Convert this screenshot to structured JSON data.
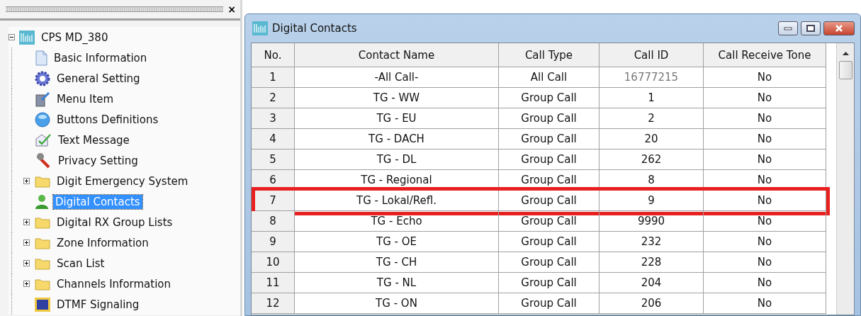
{
  "panel": {
    "close": "×"
  },
  "tree": {
    "label": "CPS MD_380",
    "expanded": true,
    "children": [
      {
        "label": "Basic Information",
        "kind": "document",
        "selected": false
      },
      {
        "label": "General Setting",
        "kind": "gear",
        "selected": false
      },
      {
        "label": "Menu Item",
        "kind": "menu",
        "selected": false
      },
      {
        "label": "Buttons Definitions",
        "kind": "ball",
        "selected": false
      },
      {
        "label": "Text Message",
        "kind": "message",
        "selected": false
      },
      {
        "label": "Privacy Setting",
        "kind": "tool",
        "selected": false
      },
      {
        "label": "Digit Emergency System",
        "kind": "folder",
        "selected": false
      },
      {
        "label": "Digital Contacts",
        "kind": "person",
        "selected": true
      },
      {
        "label": "Digital RX Group Lists",
        "kind": "folder",
        "selected": false
      },
      {
        "label": "Zone Information",
        "kind": "folder",
        "selected": false
      },
      {
        "label": "Scan List",
        "kind": "folder",
        "selected": false
      },
      {
        "label": "Channels Information",
        "kind": "folder",
        "selected": false
      },
      {
        "label": "DTMF Signaling",
        "kind": "dtmf",
        "selected": false
      }
    ]
  },
  "window": {
    "title": "Digital Contacts"
  },
  "table": {
    "columns": [
      "No.",
      "Contact Name",
      "Call Type",
      "Call ID",
      "Call Receive Tone"
    ],
    "rows": [
      {
        "cells": [
          "1",
          "-All Call-",
          "All Call",
          "16777215",
          "No"
        ],
        "id_disabled": true,
        "highlighted": false
      },
      {
        "cells": [
          "2",
          "TG - WW",
          "Group Call",
          "1",
          "No"
        ],
        "id_disabled": false,
        "highlighted": false
      },
      {
        "cells": [
          "3",
          "TG - EU",
          "Group Call",
          "2",
          "No"
        ],
        "id_disabled": false,
        "highlighted": false
      },
      {
        "cells": [
          "4",
          "TG - DACH",
          "Group Call",
          "20",
          "No"
        ],
        "id_disabled": false,
        "highlighted": false
      },
      {
        "cells": [
          "5",
          "TG - DL",
          "Group Call",
          "262",
          "No"
        ],
        "id_disabled": false,
        "highlighted": false
      },
      {
        "cells": [
          "6",
          "TG - Regional",
          "Group Call",
          "8",
          "No"
        ],
        "id_disabled": false,
        "highlighted": false
      },
      {
        "cells": [
          "7",
          "TG - Lokal/Refl.",
          "Group Call",
          "9",
          "No"
        ],
        "id_disabled": false,
        "highlighted": true
      },
      {
        "cells": [
          "8",
          "TG - Echo",
          "Group Call",
          "9990",
          "No"
        ],
        "id_disabled": false,
        "highlighted": false
      },
      {
        "cells": [
          "9",
          "TG - OE",
          "Group Call",
          "232",
          "No"
        ],
        "id_disabled": false,
        "highlighted": false
      },
      {
        "cells": [
          "10",
          "TG - CH",
          "Group Call",
          "228",
          "No"
        ],
        "id_disabled": false,
        "highlighted": false
      },
      {
        "cells": [
          "11",
          "TG - NL",
          "Group Call",
          "204",
          "No"
        ],
        "id_disabled": false,
        "highlighted": false
      },
      {
        "cells": [
          "12",
          "TG - ON",
          "Group Call",
          "206",
          "No"
        ],
        "id_disabled": false,
        "highlighted": false
      }
    ]
  }
}
